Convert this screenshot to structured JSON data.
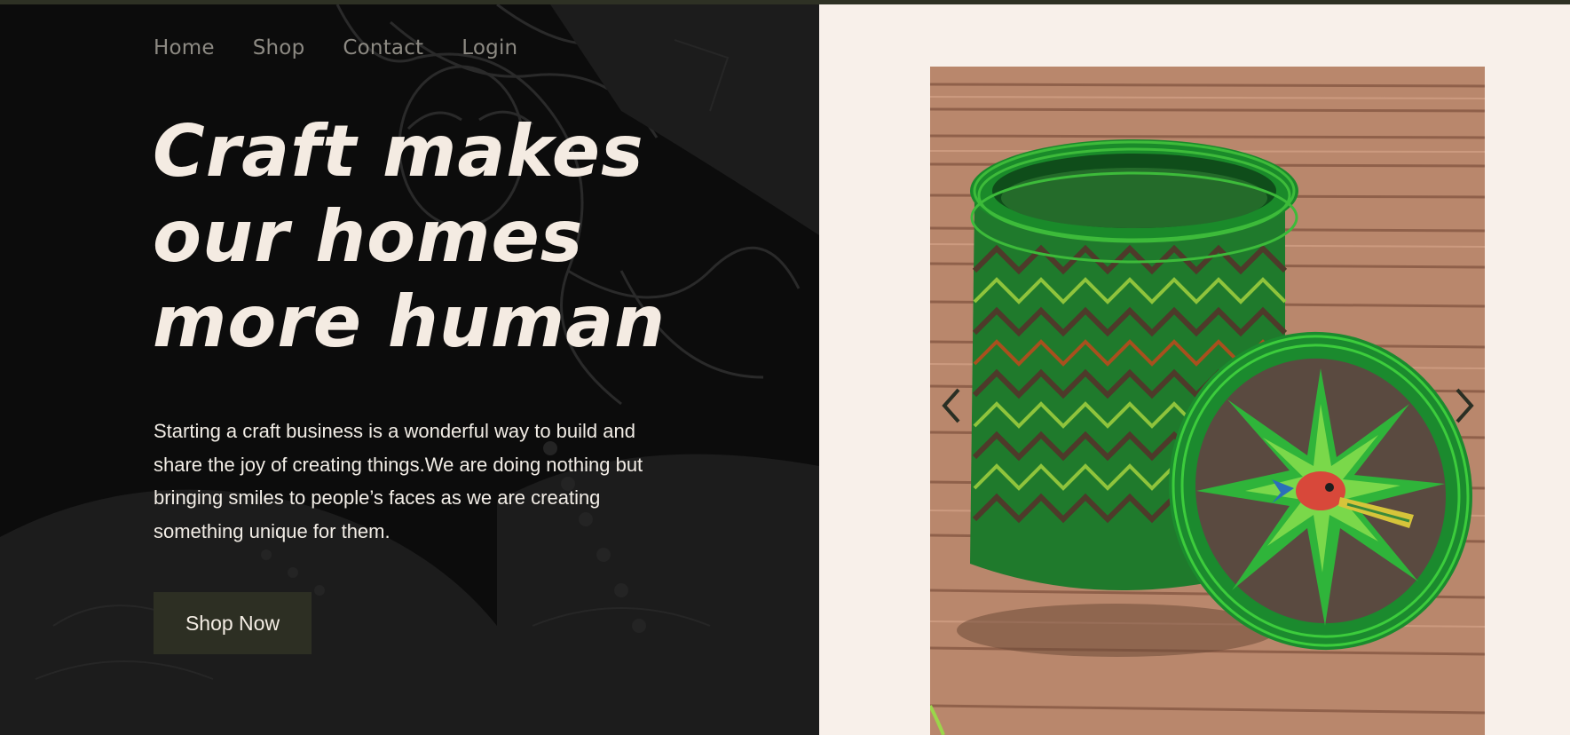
{
  "nav": {
    "items": [
      {
        "label": "Home"
      },
      {
        "label": "Shop"
      },
      {
        "label": "Contact"
      },
      {
        "label": "Login"
      }
    ]
  },
  "hero": {
    "headline_lines": [
      "Craft makes",
      "our homes",
      "more human"
    ],
    "description": "Starting a craft business is a wonderful way to build and share the joy of creating things.We are doing nothing but bringing smiles to people’s faces as we are creating something unique for them.",
    "cta_label": "Shop Now"
  },
  "carousel": {
    "image_subject": "green woven basket with lid",
    "prev_icon": "chevron-left-icon",
    "next_icon": "chevron-right-icon"
  },
  "colors": {
    "accent_dark": "#2d2f23",
    "left_bg": "#0c0c0c",
    "right_bg": "#f8f0ea",
    "headline": "#f4ebe2"
  }
}
